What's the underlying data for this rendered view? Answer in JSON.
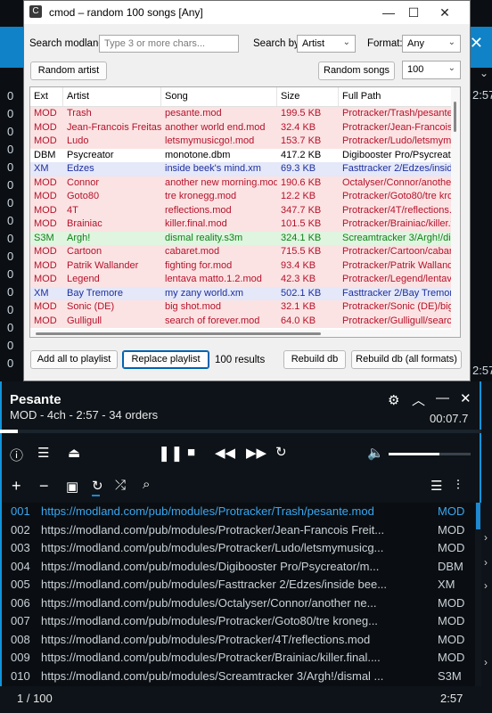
{
  "background": {
    "times": [
      "2:57",
      "2:57"
    ],
    "left_digits": [
      "0",
      "0",
      "0",
      "0",
      "0",
      "0",
      "0",
      "0",
      "0",
      "0",
      "0",
      "0",
      "0",
      "0",
      "0",
      "0"
    ],
    "accent": "#0f82c8"
  },
  "dialog": {
    "title": "cmod – random 100 songs [Any]",
    "search_label": "Search modland:",
    "search_placeholder": "Type 3 or more chars...",
    "search_by_label": "Search by:",
    "search_by_value": "Artist",
    "format_label": "Format:",
    "format_value": "Any",
    "random_artist": "Random artist",
    "random_songs": "Random songs",
    "count_value": "100",
    "columns": [
      "Ext",
      "Artist",
      "Song",
      "Size",
      "Full Path"
    ],
    "rows": [
      {
        "ext": "MOD",
        "artist": "Trash",
        "song": "pesante.mod",
        "size": "199.5 KB",
        "path": "Protracker/Trash/pesante.mod",
        "type": "mod"
      },
      {
        "ext": "MOD",
        "artist": "Jean-Francois Freitas",
        "song": "another world end.mod",
        "size": "32.4 KB",
        "path": "Protracker/Jean-Francois Freitas",
        "type": "mod"
      },
      {
        "ext": "MOD",
        "artist": "Ludo",
        "song": "letsmymusicgo!.mod",
        "size": "153.7 KB",
        "path": "Protracker/Ludo/letsmymusicgo",
        "type": "mod"
      },
      {
        "ext": "DBM",
        "artist": "Psycreator",
        "song": "monotone.dbm",
        "size": "417.2 KB",
        "path": "Digibooster Pro/Psycreator/m",
        "type": "dbm"
      },
      {
        "ext": "XM",
        "artist": "Edzes",
        "song": "inside beek's mind.xm",
        "size": "69.3 KB",
        "path": "Fasttracker 2/Edzes/inside bee",
        "type": "xm"
      },
      {
        "ext": "MOD",
        "artist": "Connor",
        "song": "another new morning.mod",
        "size": "190.6 KB",
        "path": "Octalyser/Connor/another new",
        "type": "mod"
      },
      {
        "ext": "MOD",
        "artist": "Goto80",
        "song": "tre kronegg.mod",
        "size": "12.2 KB",
        "path": "Protracker/Goto80/tre kronegg",
        "type": "mod"
      },
      {
        "ext": "MOD",
        "artist": "4T",
        "song": "reflections.mod",
        "size": "347.7 KB",
        "path": "Protracker/4T/reflections.mod",
        "type": "mod"
      },
      {
        "ext": "MOD",
        "artist": "Brainiac",
        "song": "killer.final.mod",
        "size": "101.5 KB",
        "path": "Protracker/Brainiac/killer.final",
        "type": "mod"
      },
      {
        "ext": "S3M",
        "artist": "Argh!",
        "song": "dismal reality.s3m",
        "size": "324.1 KB",
        "path": "Screamtracker 3/Argh!/dismal",
        "type": "s3m"
      },
      {
        "ext": "MOD",
        "artist": "Cartoon",
        "song": "cabaret.mod",
        "size": "715.5 KB",
        "path": "Protracker/Cartoon/cabaret.mod",
        "type": "mod"
      },
      {
        "ext": "MOD",
        "artist": "Patrik Wallander",
        "song": "fighting for.mod",
        "size": "93.4 KB",
        "path": "Protracker/Patrik Wallander",
        "type": "mod"
      },
      {
        "ext": "MOD",
        "artist": "Legend",
        "song": "lentava matto.1.2.mod",
        "size": "42.3 KB",
        "path": "Protracker/Legend/lentava mat",
        "type": "mod"
      },
      {
        "ext": "XM",
        "artist": "Bay Tremore",
        "song": "my zany world.xm",
        "size": "502.1 KB",
        "path": "Fasttracker 2/Bay Tremore/my",
        "type": "xm"
      },
      {
        "ext": "MOD",
        "artist": "Sonic (DE)",
        "song": "big shot.mod",
        "size": "32.1 KB",
        "path": "Protracker/Sonic (DE)/big shot",
        "type": "mod"
      },
      {
        "ext": "MOD",
        "artist": "Gulligull",
        "song": "search of forever.mod",
        "size": "64.0 KB",
        "path": "Protracker/Gulligull/search of",
        "type": "mod"
      }
    ],
    "add_all": "Add all to playlist",
    "replace": "Replace playlist",
    "results": "100 results",
    "rebuild": "Rebuild db",
    "rebuild_all": "Rebuild db (all formats)"
  },
  "player": {
    "title": "Pesante",
    "subtitle": "MOD - 4ch - 2:57 - 34 orders",
    "elapsed": "00:07.7",
    "progress": 0.037,
    "volume": 0.62,
    "playlist": [
      {
        "n": "001",
        "url": "https://modland.com/pub/modules/Protracker/Trash/pesante.mod",
        "ext": "MOD"
      },
      {
        "n": "002",
        "url": "https://modland.com/pub/modules/Protracker/Jean-Francois Freit...",
        "ext": "MOD"
      },
      {
        "n": "003",
        "url": "https://modland.com/pub/modules/Protracker/Ludo/letsmymusicg...",
        "ext": "MOD"
      },
      {
        "n": "004",
        "url": "https://modland.com/pub/modules/Digibooster Pro/Psycreator/m...",
        "ext": "DBM"
      },
      {
        "n": "005",
        "url": "https://modland.com/pub/modules/Fasttracker 2/Edzes/inside bee...",
        "ext": "XM"
      },
      {
        "n": "006",
        "url": "https://modland.com/pub/modules/Octalyser/Connor/another ne...",
        "ext": "MOD"
      },
      {
        "n": "007",
        "url": "https://modland.com/pub/modules/Protracker/Goto80/tre kroneg...",
        "ext": "MOD"
      },
      {
        "n": "008",
        "url": "https://modland.com/pub/modules/Protracker/4T/reflections.mod",
        "ext": "MOD"
      },
      {
        "n": "009",
        "url": "https://modland.com/pub/modules/Protracker/Brainiac/killer.final....",
        "ext": "MOD"
      },
      {
        "n": "010",
        "url": "https://modland.com/pub/modules/Screamtracker 3/Argh!/dismal ...",
        "ext": "S3M"
      }
    ],
    "count": "1 / 100",
    "total": "2:57"
  },
  "colors": {
    "mod": "#fbe3e3",
    "xm": "#e4e8f8",
    "s3m": "#dff5df",
    "dbm": "#ffffff",
    "mod_text": "#b5122b",
    "xm_text": "#1e2f9e",
    "s3m_text": "#11801a",
    "dbm_text": "#000000"
  }
}
